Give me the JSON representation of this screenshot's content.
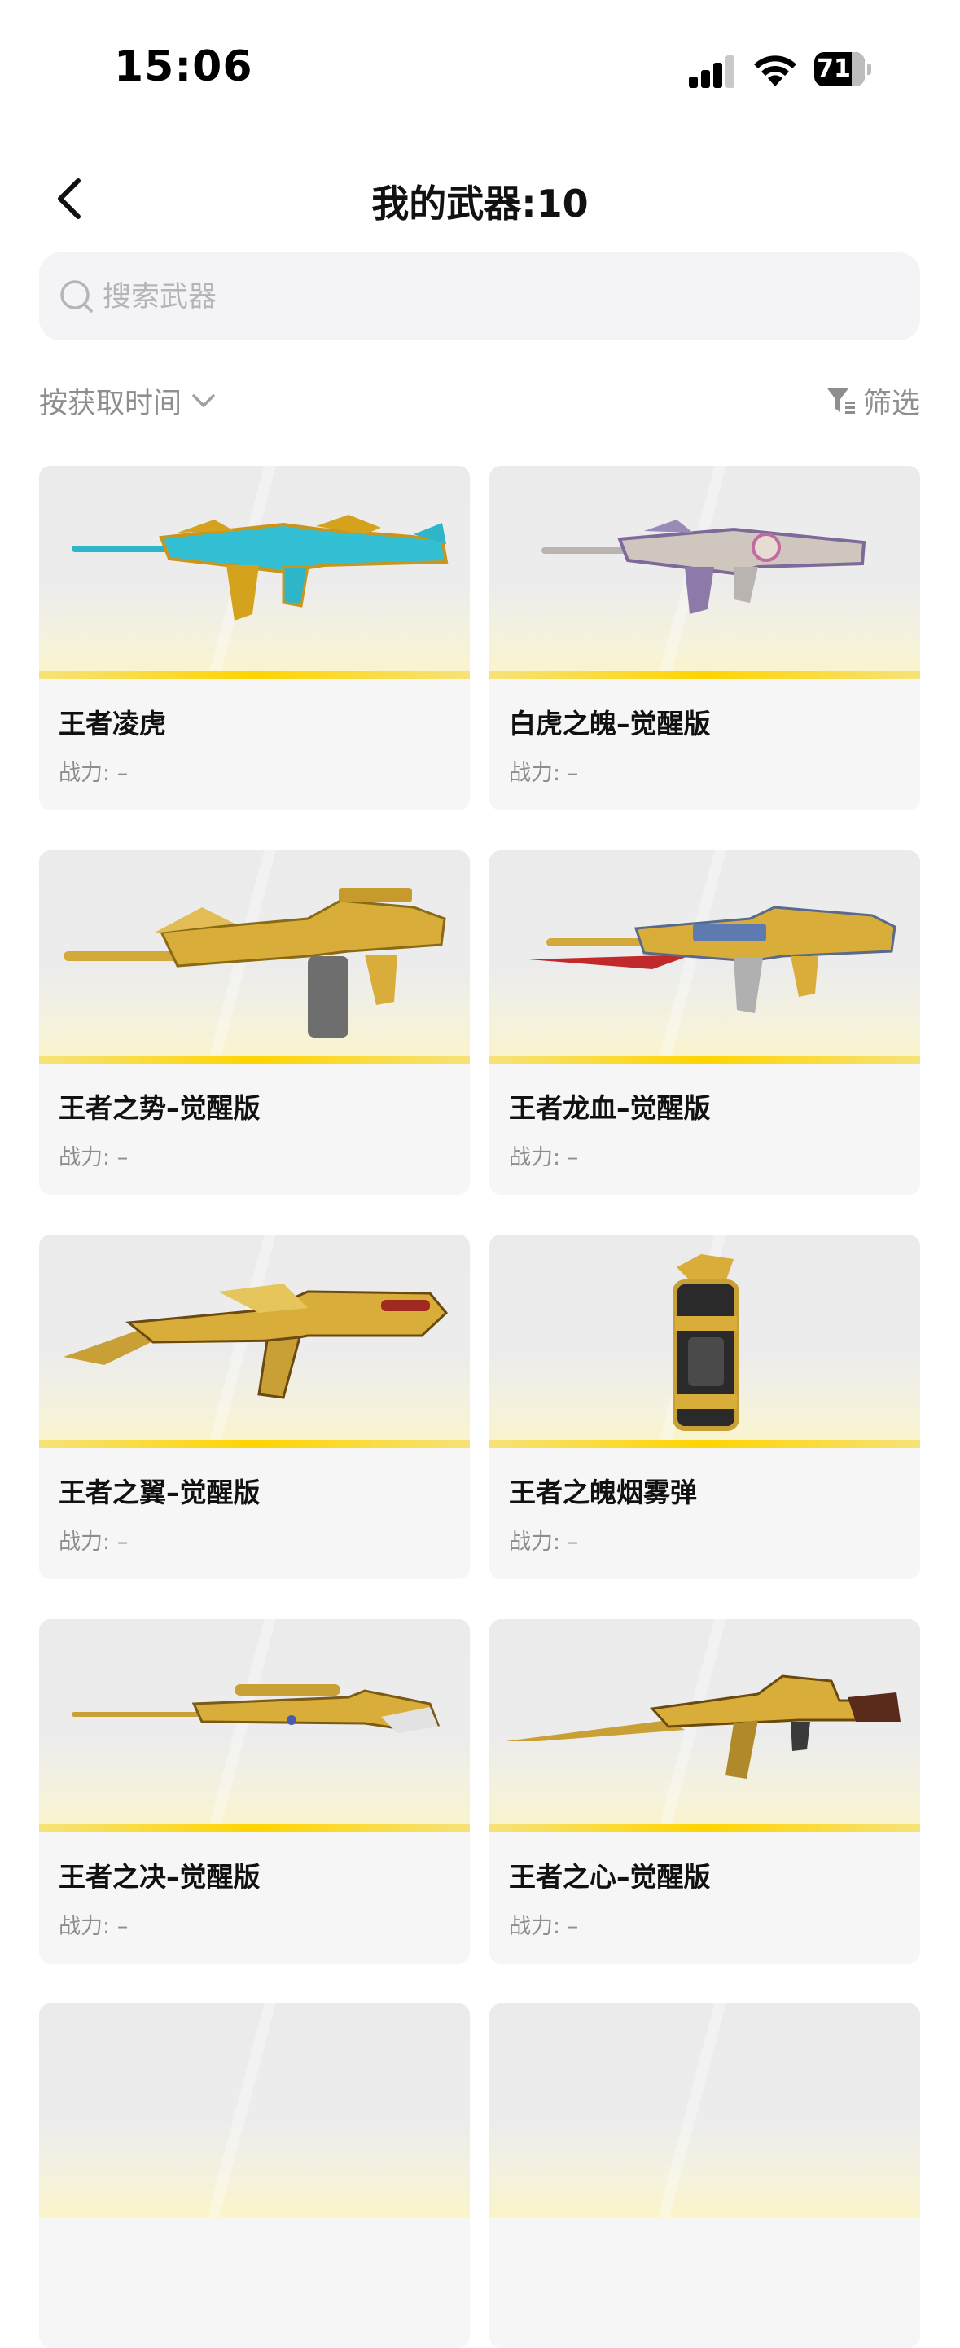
{
  "status": {
    "time": "15:06",
    "battery": "71"
  },
  "nav": {
    "title": "我的武器:10"
  },
  "search": {
    "placeholder": "搜索武器"
  },
  "sort": {
    "label": "按获取时间"
  },
  "filter": {
    "label": "筛选"
  },
  "power_label": "战力:",
  "weapons": [
    {
      "name": "王者凌虎",
      "power": "–",
      "icon": "rifle-cyan-gold"
    },
    {
      "name": "白虎之魄–觉醒版",
      "power": "–",
      "icon": "rifle-silver-purple"
    },
    {
      "name": "王者之势–觉醒版",
      "power": "–",
      "icon": "rifle-gold-m4"
    },
    {
      "name": "王者龙血–觉醒版",
      "power": "–",
      "icon": "rifle-gold-red-blade"
    },
    {
      "name": "王者之翼–觉醒版",
      "power": "–",
      "icon": "rifle-gold-ak-wing"
    },
    {
      "name": "王者之魄烟雾弹",
      "power": "–",
      "icon": "smoke-grenade-gold"
    },
    {
      "name": "王者之决–觉醒版",
      "power": "–",
      "icon": "sniper-gold"
    },
    {
      "name": "王者之心–觉醒版",
      "power": "–",
      "icon": "rifle-gold-ak-blade"
    }
  ]
}
